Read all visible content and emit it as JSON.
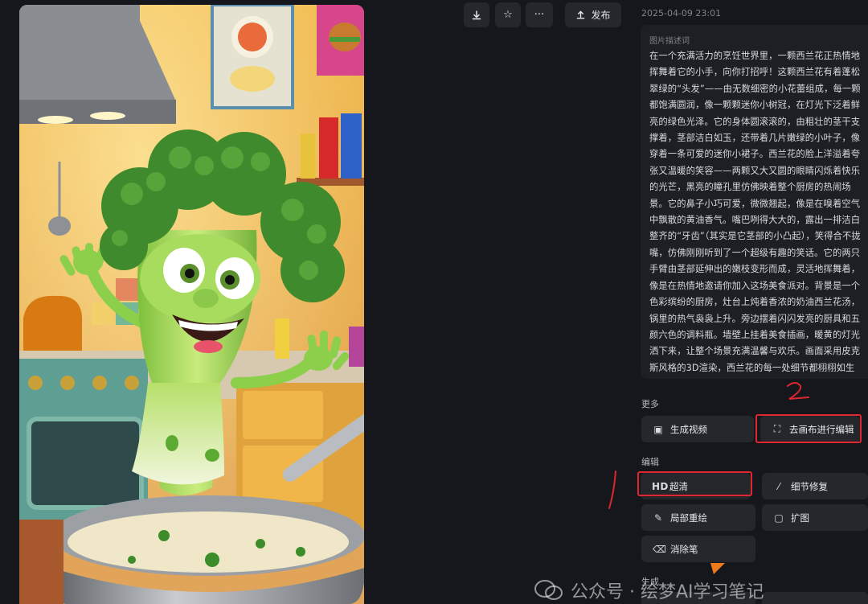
{
  "toolbar": {
    "download_icon": "download-icon",
    "star_icon": "star-icon",
    "more_icon": "more-horizontal-icon",
    "publish_label": "发布"
  },
  "meta": {
    "date": "2025-04-09 23:01"
  },
  "description": {
    "label": "图片描述词",
    "text": "在一个充满活力的烹饪世界里，一颗西兰花正热情地挥舞着它的小手，向你打招呼！这颗西兰花有着蓬松翠绿的“头发”——由无数细密的小花蕾组成，每一颗都饱满圆润，像一颗颗迷你小树冠，在灯光下泛着鲜亮的绿色光泽。它的身体圆滚滚的，由粗壮的茎干支撑着，茎部洁白如玉，还带着几片嫩绿的小叶子，像穿着一条可爱的迷你小裙子。西兰花的脸上洋溢着夸张又温暖的笑容——两颗又大又圆的眼睛闪烁着快乐的光芒，黑亮的瞳孔里仿佛映着整个厨房的热闹场景。它的鼻子小巧可爱，微微翘起，像是在嗅着空气中飘散的黄油香气。嘴巴咧得大大的，露出一排洁白整齐的“牙齿”（其实是它茎部的小凸起），笑得合不拢嘴，仿佛刚刚听到了一个超级有趣的笑话。它的两只手臂由茎部延伸出的嫩枝变形而成，灵活地挥舞着，像是在热情地邀请你加入这场美食派对。背景是一个色彩缤纷的厨房，灶台上炖着香浓的奶油西兰花汤，锅里的热气袅袅上升。旁边摆着闪闪发亮的厨具和五颜六色的调料瓶。墙壁上挂着美食插画，暖黄的灯光洒下来，让整个场景充满温馨与欢乐。画面采用皮克斯风格的3D渲染，西兰花的每一处细节都栩栩如生——花蕾的纹理、茎部的光泽、叶子的脉络，甚"
  },
  "more_section": {
    "title": "更多",
    "buttons": [
      {
        "icon": "video-icon",
        "label": "生成视频"
      },
      {
        "icon": "canvas-icon",
        "label": "去画布进行编辑"
      }
    ]
  },
  "edit_section": {
    "title": "编辑",
    "buttons": [
      {
        "icon": "hd-icon",
        "icon_text": "HD",
        "label": "超清"
      },
      {
        "icon": "magic-wand-icon",
        "label": "细节修复"
      },
      {
        "icon": "brush-icon",
        "label": "局部重绘"
      },
      {
        "icon": "expand-icon",
        "label": "扩图"
      },
      {
        "icon": "eraser-icon",
        "label": "消除笔"
      }
    ]
  },
  "generate_section": {
    "title": "生成"
  },
  "annotations": {
    "mark_1": "1",
    "mark_2": "2",
    "color": "#e0262f"
  },
  "watermark": {
    "text": "公众号 · 绘梦AI学习笔记",
    "logo": "wechat-logo-icon"
  },
  "colors": {
    "background": "#15171c",
    "panel": "#1d1f24",
    "button": "#25272d",
    "accent_red": "#e0262f"
  }
}
